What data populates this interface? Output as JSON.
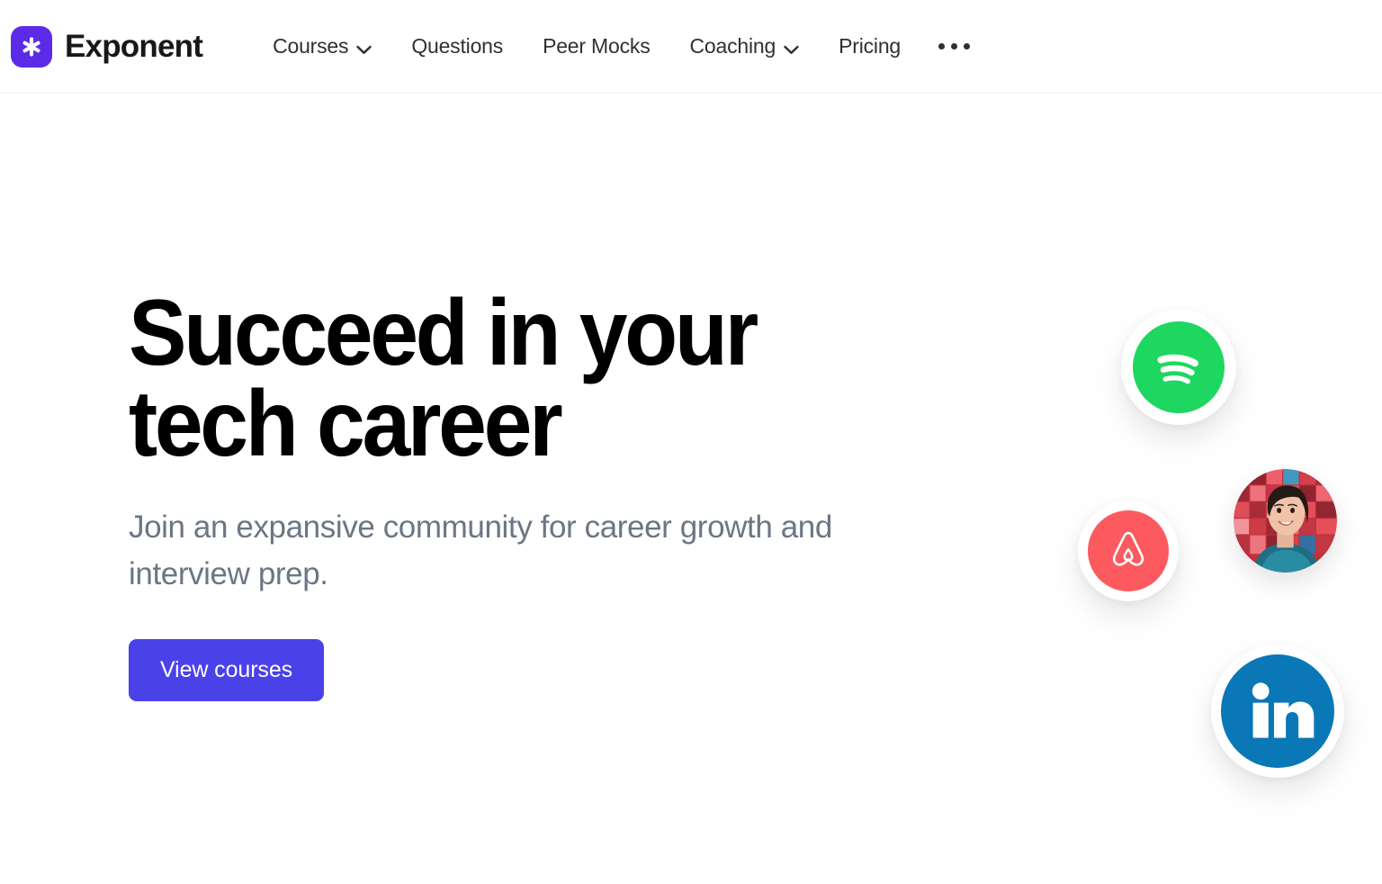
{
  "brand": {
    "name": "Exponent",
    "logo_icon": "asterisk-icon",
    "logo_color": "#5b2be8"
  },
  "nav": {
    "items": [
      {
        "label": "Courses",
        "has_dropdown": true,
        "icon": "chevron-down-icon"
      },
      {
        "label": "Questions",
        "has_dropdown": false,
        "icon": ""
      },
      {
        "label": "Peer Mocks",
        "has_dropdown": false,
        "icon": ""
      },
      {
        "label": "Coaching",
        "has_dropdown": true,
        "icon": "chevron-down-icon"
      },
      {
        "label": "Pricing",
        "has_dropdown": false,
        "icon": ""
      }
    ],
    "more_icon": "ellipsis-icon"
  },
  "hero": {
    "title_line1": "Succeed in your",
    "title_line2": "tech career",
    "subtitle": "Join an expansive community for career growth and interview prep.",
    "cta_label": "View courses",
    "cta_color": "#4a41e8",
    "subtitle_color": "#6c7684"
  },
  "logo_cluster": {
    "badges": [
      {
        "name": "spotify",
        "icon": "spotify-icon",
        "color": "#1ed760"
      },
      {
        "name": "airbnb",
        "icon": "airbnb-icon",
        "color": "#fc5a5f"
      },
      {
        "name": "avatar",
        "icon": "user-avatar",
        "color": "#d94a55"
      },
      {
        "name": "linkedin",
        "icon": "linkedin-icon",
        "color": "#0a77b6",
        "mark": "in"
      }
    ]
  }
}
